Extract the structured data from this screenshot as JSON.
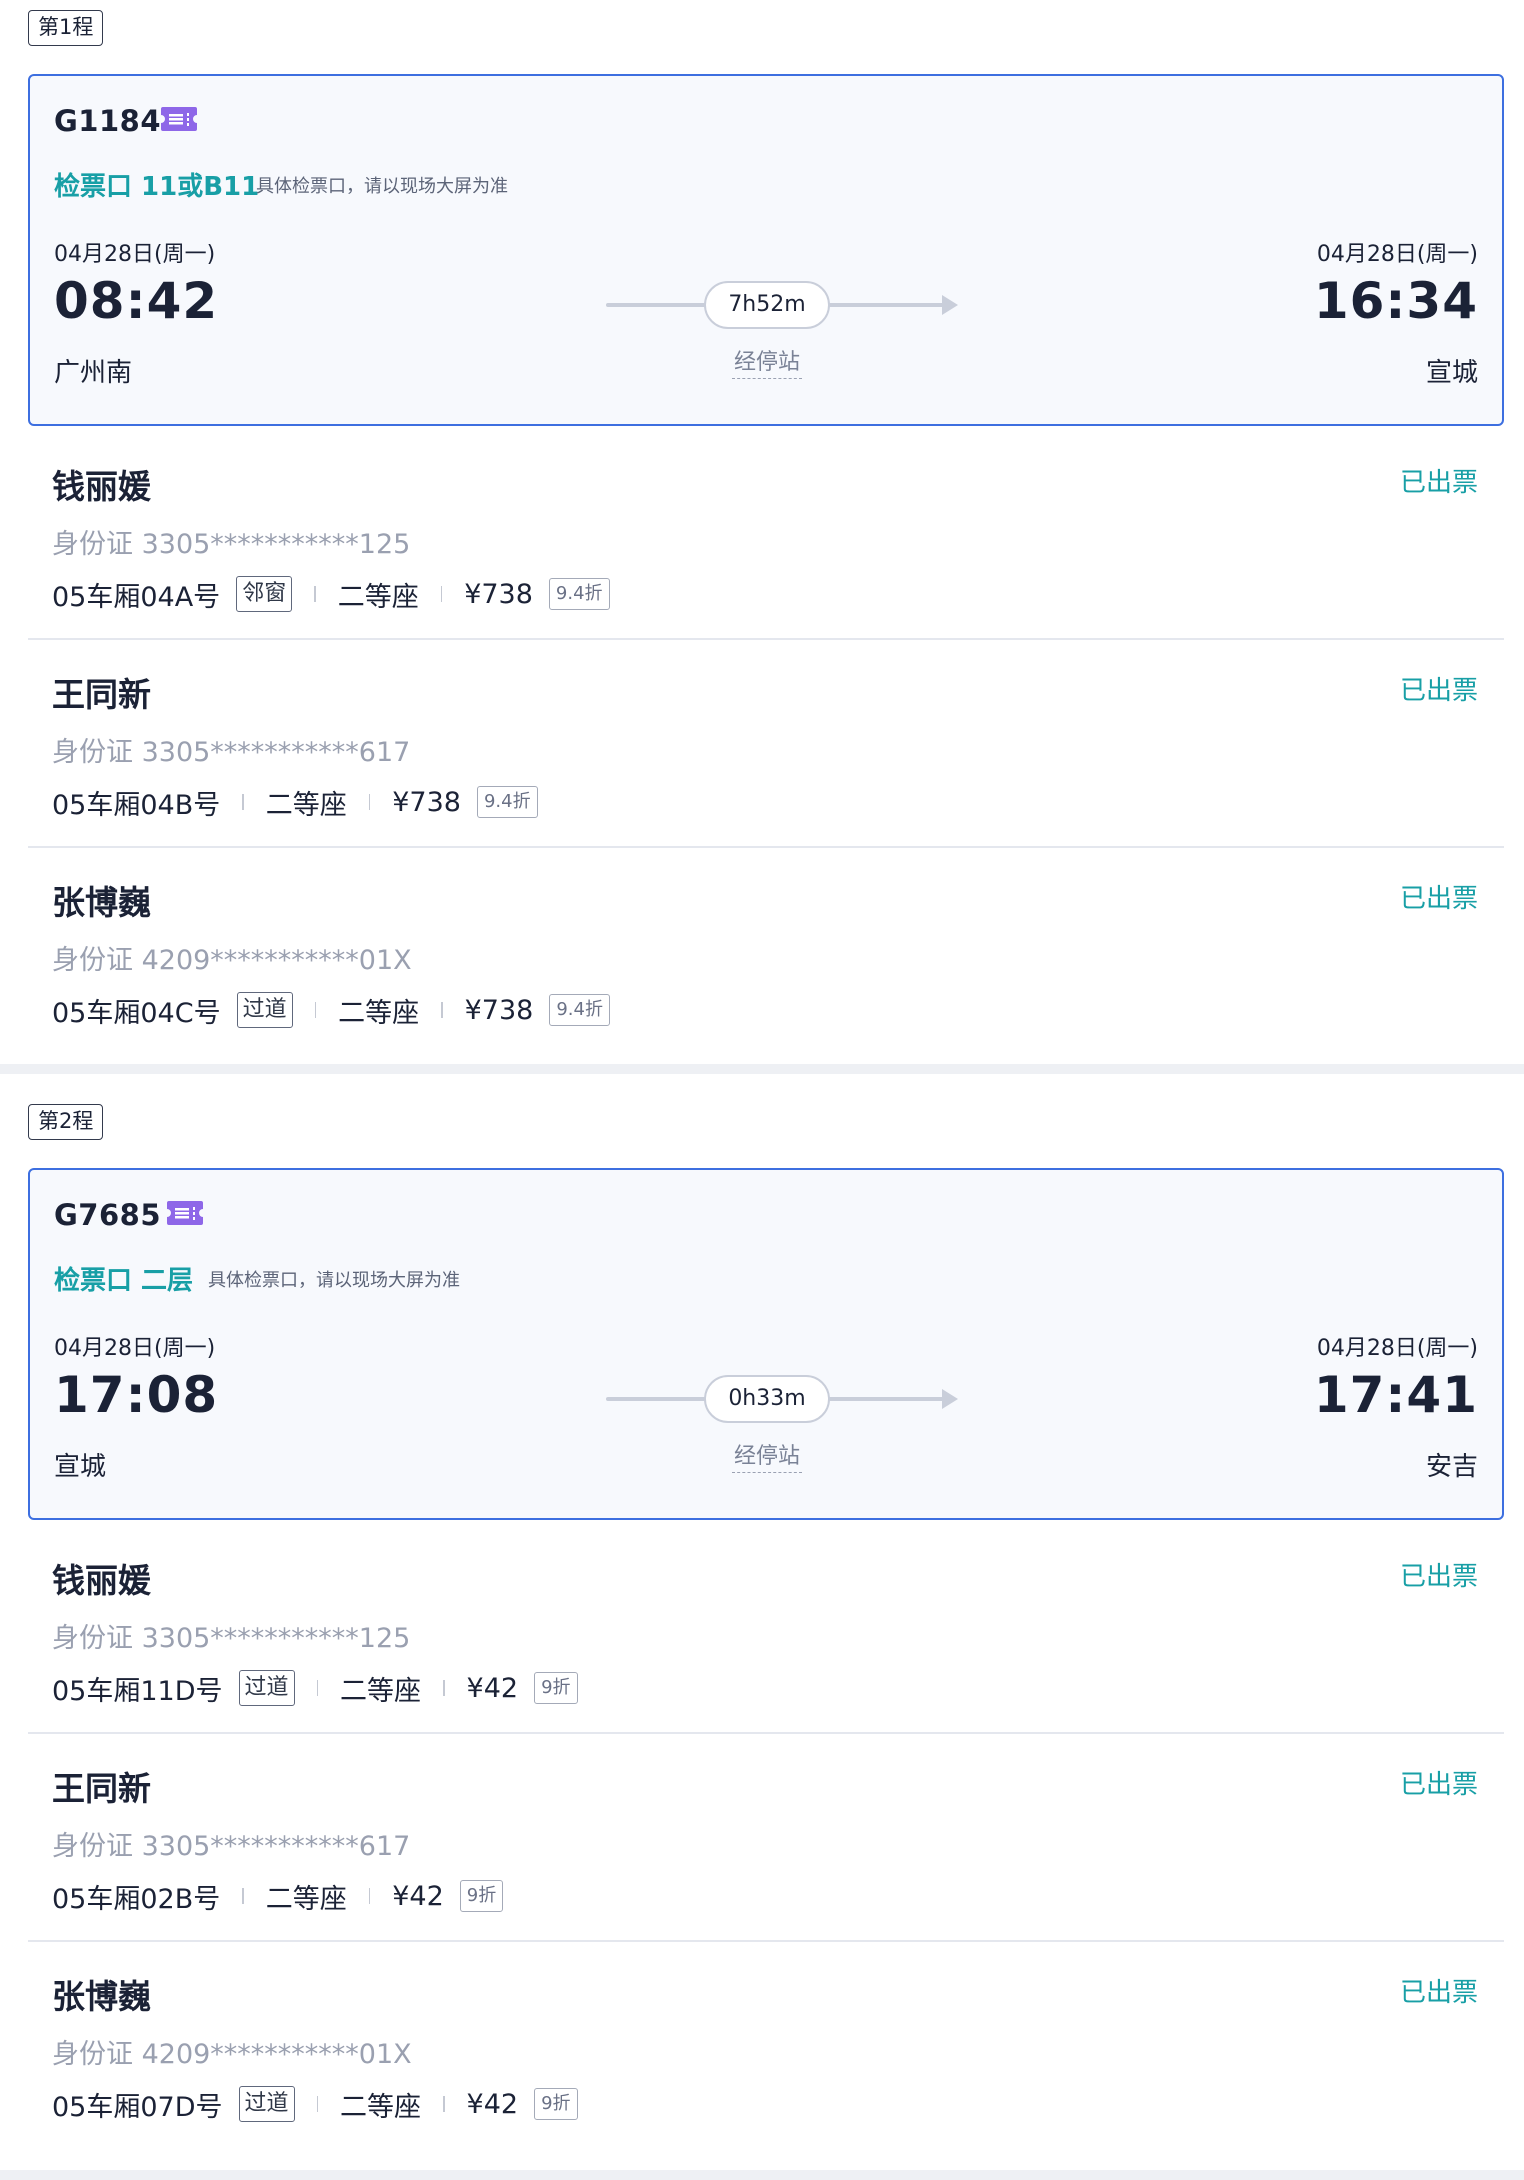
{
  "trips": [
    {
      "label": "第1程",
      "train_no": "G1184",
      "gate_label": "检票口 11或B11",
      "gate_note": "具体检票口，请以现场大屏为准",
      "depart_date": "04月28日(周一)",
      "arrive_date": "04月28日(周一)",
      "depart_time": "08:42",
      "arrive_time": "16:34",
      "depart_station": "广州南",
      "arrive_station": "宣城",
      "duration": "7h52m",
      "stops_label": "经停站",
      "passengers": [
        {
          "name": "钱丽媛",
          "status": "已出票",
          "id": "身份证 3305***********125",
          "seat": "05车厢04A号",
          "badge": "邻窗",
          "seat_class": "二等座",
          "price": "¥738",
          "discount": "9.4折"
        },
        {
          "name": "王同新",
          "status": "已出票",
          "id": "身份证 3305***********617",
          "seat": "05车厢04B号",
          "badge": "",
          "seat_class": "二等座",
          "price": "¥738",
          "discount": "9.4折"
        },
        {
          "name": "张博巍",
          "status": "已出票",
          "id": "身份证 4209***********01X",
          "seat": "05车厢04C号",
          "badge": "过道",
          "seat_class": "二等座",
          "price": "¥738",
          "discount": "9.4折"
        }
      ]
    },
    {
      "label": "第2程",
      "train_no": "G7685",
      "gate_label": "检票口 二层",
      "gate_note": "具体检票口，请以现场大屏为准",
      "depart_date": "04月28日(周一)",
      "arrive_date": "04月28日(周一)",
      "depart_time": "17:08",
      "arrive_time": "17:41",
      "depart_station": "宣城",
      "arrive_station": "安吉",
      "duration": "0h33m",
      "stops_label": "经停站",
      "passengers": [
        {
          "name": "钱丽媛",
          "status": "已出票",
          "id": "身份证 3305***********125",
          "seat": "05车厢11D号",
          "badge": "过道",
          "seat_class": "二等座",
          "price": "¥42",
          "discount": "9折"
        },
        {
          "name": "王同新",
          "status": "已出票",
          "id": "身份证 3305***********617",
          "seat": "05车厢02B号",
          "badge": "",
          "seat_class": "二等座",
          "price": "¥42",
          "discount": "9折"
        },
        {
          "name": "张博巍",
          "status": "已出票",
          "id": "身份证 4209***********01X",
          "seat": "05车厢07D号",
          "badge": "过道",
          "seat_class": "二等座",
          "price": "¥42",
          "discount": "9折"
        }
      ]
    }
  ],
  "colors": {
    "accent_blue": "#3d6fe0",
    "gate_teal": "#189fa6",
    "ticket_purple": "#8e67e8",
    "text_dark": "#1b2236"
  },
  "icons": {
    "ticket": "ticket-icon"
  }
}
